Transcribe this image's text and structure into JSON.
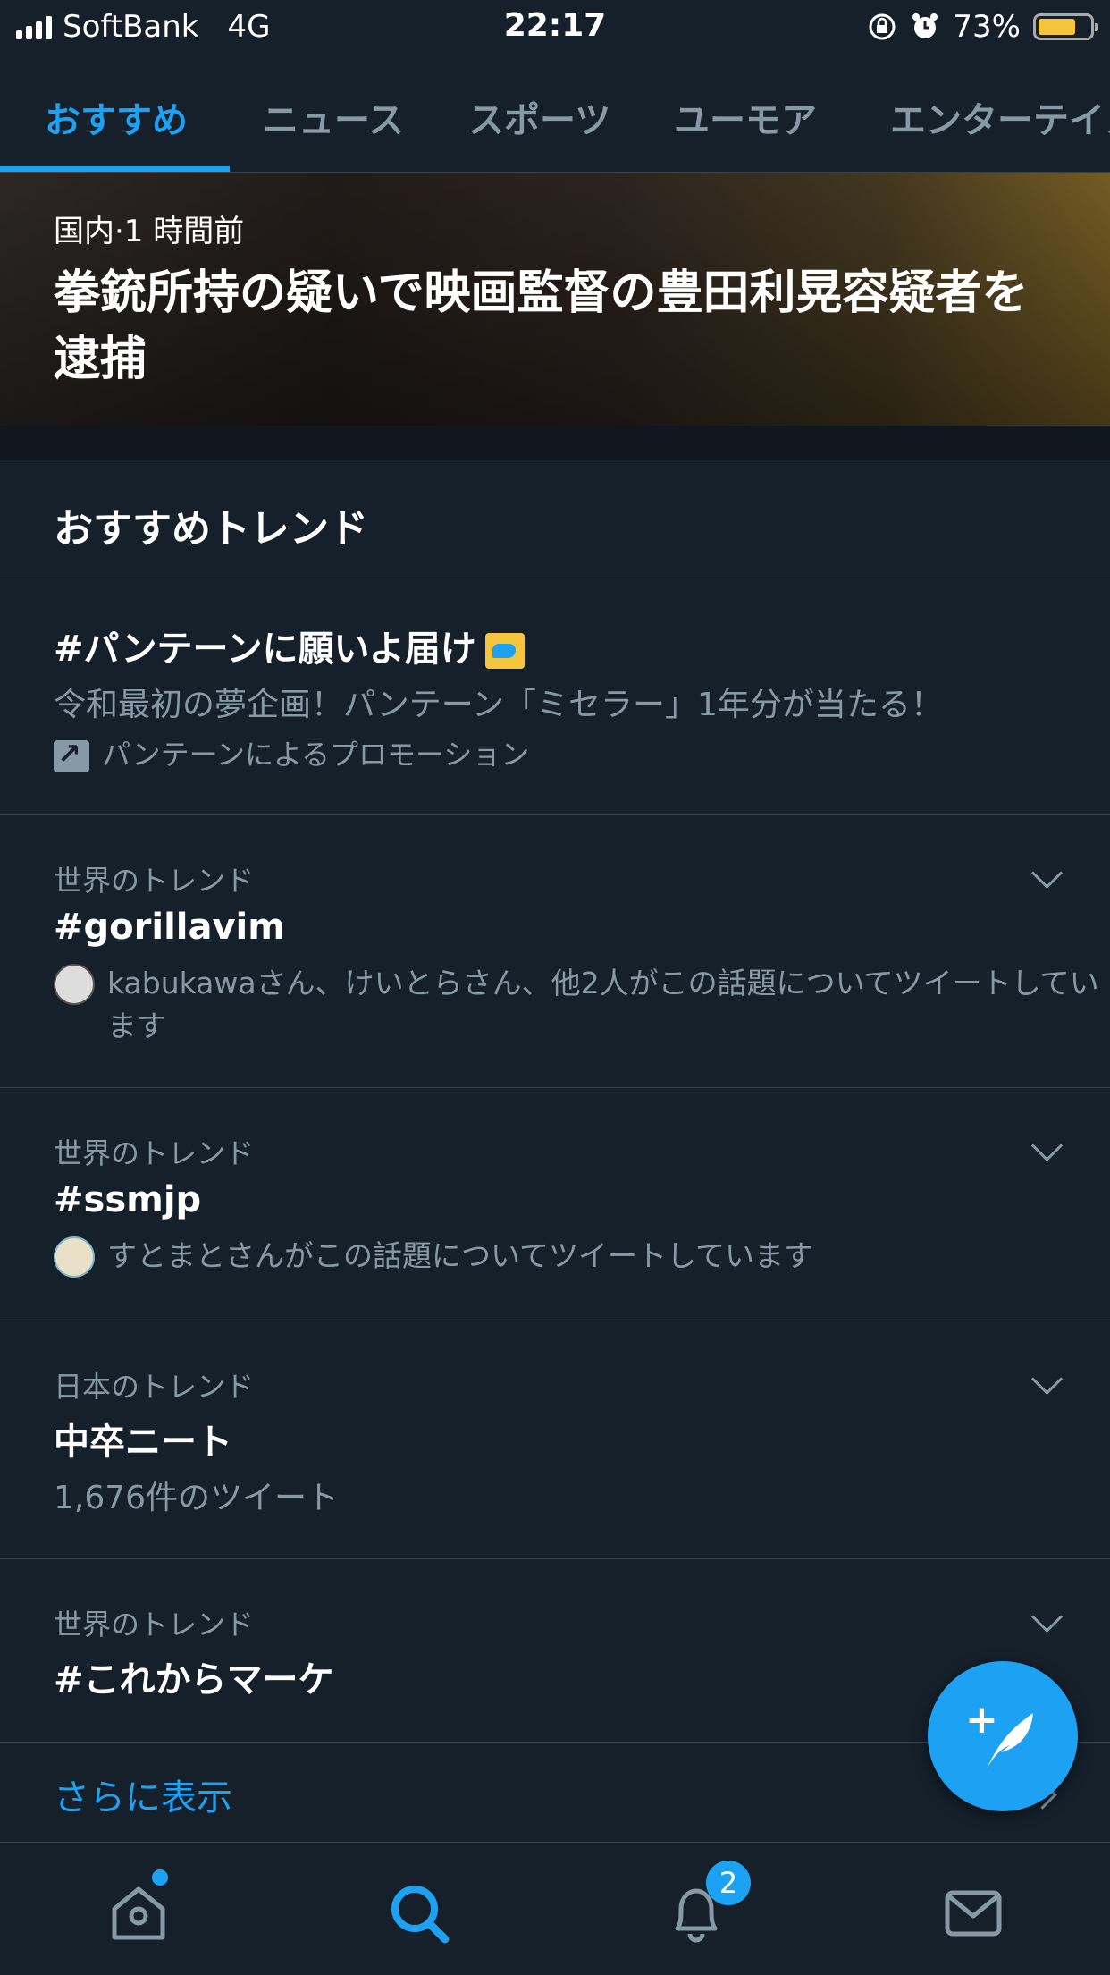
{
  "status_bar": {
    "carrier": "SoftBank",
    "network": "4G",
    "time": "22:17",
    "battery": "73%",
    "battery_level": 0.73
  },
  "tabs": [
    {
      "label": "おすすめ",
      "active": true
    },
    {
      "label": "ニュース",
      "active": false
    },
    {
      "label": "スポーツ",
      "active": false
    },
    {
      "label": "ユーモア",
      "active": false
    },
    {
      "label": "エンターテイメ",
      "active": false
    }
  ],
  "hero": {
    "meta": "国内·1 時間前",
    "title": "拳銃所持の疑いで映画監督の豊田利晃容疑者を逮捕"
  },
  "section": {
    "title": "おすすめトレンド"
  },
  "promoted": {
    "name": "#パンテーンに願いよ届け",
    "description": "令和最初の夢企画！パンテーン「ミセラー」1年分が当たる！",
    "promo_label": "パンテーンによるプロモーション"
  },
  "trends": [
    {
      "context": "世界のトレンド",
      "name": "#gorillavim",
      "detail": "kabukawaさん、けいとらさん、他2人がこの話題についてツイートしています"
    },
    {
      "context": "世界のトレンド",
      "name": "#ssmjp",
      "detail": "すとまとさんがこの話題についてツイートしています"
    },
    {
      "context": "日本のトレンド",
      "name": "中卒ニート",
      "detail": "1,676件のツイート"
    },
    {
      "context": "世界のトレンド",
      "name": "#これからマーケ",
      "detail": ""
    }
  ],
  "show_more": "さらに表示",
  "tabbar": {
    "notifications_badge": "2",
    "icons": [
      "home-icon",
      "search-icon",
      "bell-icon",
      "mail-icon"
    ]
  },
  "colors": {
    "background": "#15202b",
    "accent": "#1da1f2",
    "secondary_text": "#8899a6",
    "divider": "#38444d"
  }
}
